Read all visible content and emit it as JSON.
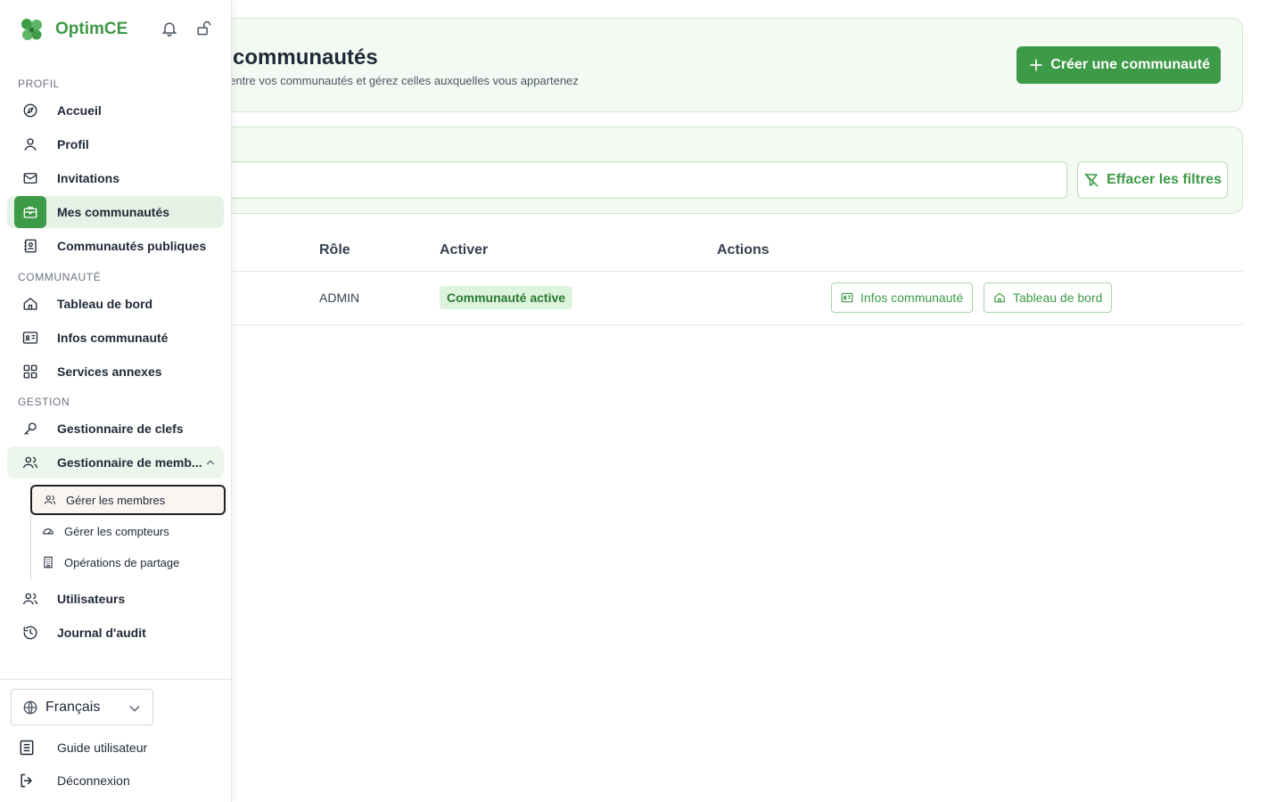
{
  "brand": {
    "name": "OptimCE"
  },
  "header": {
    "title": "communautés",
    "subtitle": "z entre vos communautés et gérez celles auxquelles vous appartenez",
    "create_label": "Créer une communauté"
  },
  "filters": {
    "search_value": "",
    "clear_label": "Effacer les filtres"
  },
  "table": {
    "columns": {
      "role": "Rôle",
      "activate": "Activer",
      "actions": "Actions"
    },
    "rows": [
      {
        "role": "ADMIN",
        "status": "Communauté active",
        "info_button": "Infos communauté",
        "dashboard_button": "Tableau de bord"
      }
    ]
  },
  "sidebar": {
    "sections": {
      "profile": "PROFIL",
      "community": "COMMUNAUTÉ",
      "management": "GESTION"
    },
    "items": {
      "home": "Accueil",
      "profile": "Profil",
      "invitations": "Invitations",
      "my_communities": "Mes communautés",
      "public_communities": "Communautés publiques",
      "dashboard": "Tableau de bord",
      "community_info": "Infos communauté",
      "services": "Services annexes",
      "keys": "Gestionnaire de clefs",
      "members": "Gestionnaire de memb...",
      "manage_members": "Gérer les membres",
      "manage_meters": "Gérer les compteurs",
      "sharing": "Opérations de partage",
      "users": "Utilisateurs",
      "audit": "Journal d'audit"
    },
    "language": "Français",
    "footer": {
      "guide": "Guide utilisateur",
      "logout": "Déconnexion"
    }
  },
  "colors": {
    "accent": "#3d9a46",
    "accent_light": "#e5f2e5",
    "badge_bg": "#dcf3dc"
  },
  "icons": [
    "logo-icon",
    "bell-icon",
    "unlock-icon",
    "compass-icon",
    "user-icon",
    "mail-icon",
    "briefcase-icon",
    "contact-book-icon",
    "home-icon",
    "id-card-icon",
    "grid-icon",
    "key-icon",
    "users-icon",
    "chevron-up-icon",
    "gauge-icon",
    "building-icon",
    "history-icon",
    "globe-icon",
    "chevron-down-icon",
    "book-icon",
    "logout-icon",
    "plus-icon",
    "filter-off-icon"
  ]
}
